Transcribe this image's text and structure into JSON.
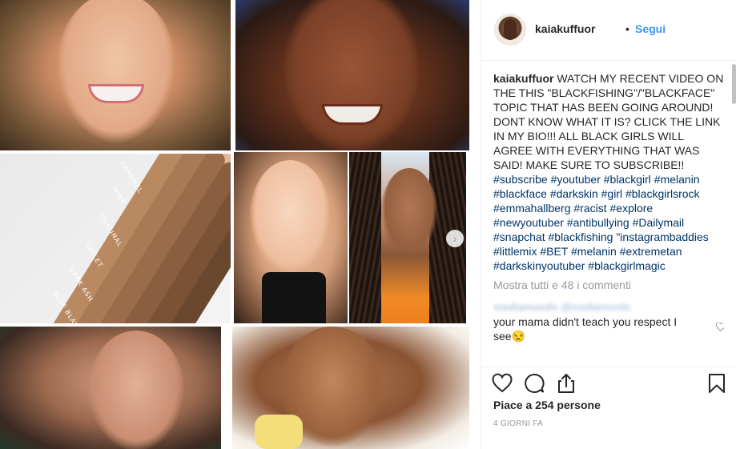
{
  "post": {
    "username": "kaiakuffuor",
    "dot": "•",
    "follow_label": "Segui",
    "caption": {
      "author": "kaiakuffuor",
      "text": "WATCH MY RECENT VIDEO ON THE THIS \"BLACKFISHING\"/\"BLACKFACE\" TOPIC THAT HAS BEEN GOING AROUND! DONT KNOW WHAT IT IS? CLICK THE LINK IN MY BIO!!! ALL BLACK GIRLS WILL AGREE WITH EVERYTHING THAT WAS SAID! MAKE SURE TO SUBSCRIBE!!",
      "hashtags": "#subscribe #youtuber #blackgirl #melanin #blackface #darkskin #girl #blackgirlsrock #emmahallberg #racist #explore #newyoutuber #antibullying #Dailymail #snapchat #blackfishing \"instagrambaddies #littlemix #BET #melanin #extremetan #darkskinyoutuber #blackgirlmagic"
    },
    "load_more": "Mostra tutti e 48 i commenti",
    "comment": {
      "user": "msdiamonds",
      "mention": "@msdiamonds",
      "text": "your mama didn't teach you respect I see😒"
    },
    "likes": "Piace a 254 persone",
    "time": "4 GIORNI FA"
  },
  "media": {
    "swatches": [
      {
        "label": "CARAMEL",
        "color": "#b98a62"
      },
      {
        "label": "MINK",
        "color": "#a97a54"
      },
      {
        "label": "ORIGINAL",
        "color": "#9a6c49"
      },
      {
        "label": "VIOLET",
        "color": "#8a5f40"
      },
      {
        "label": "DARK ASH",
        "color": "#7a5236"
      },
      {
        "label": "BLUE BLACK",
        "color": "#6a472f"
      }
    ],
    "next_glyph": "›"
  },
  "colors": {
    "link": "#3897f0",
    "hashtag": "#003569",
    "muted": "#999999"
  }
}
